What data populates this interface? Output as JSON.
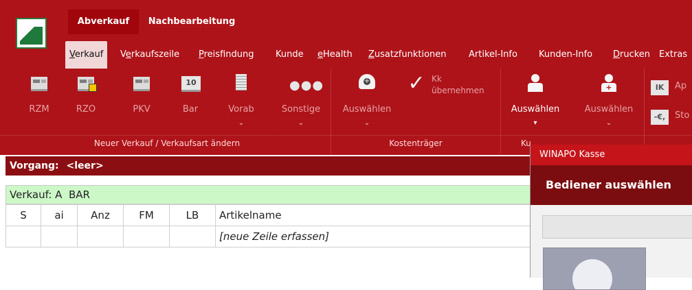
{
  "app": {
    "top_tabs": [
      "Abverkauf",
      "Nachbearbeitung"
    ],
    "menu": [
      {
        "label": "Verkauf",
        "ul": "V",
        "rest": "erkauf",
        "active": true
      },
      {
        "label": "Verkaufszeile",
        "ul": "e",
        "pre": "V",
        "rest": "rkaufszeile"
      },
      {
        "label": "Preisfindung",
        "ul": "P",
        "rest": "reisfindung"
      },
      {
        "label": "Kunde"
      },
      {
        "label": "eHealth",
        "ul": "e",
        "rest": "Health"
      },
      {
        "label": "Zusatzfunktionen",
        "ul": "Z",
        "rest": "usatzfunktionen"
      },
      {
        "label": "Artikel-Info"
      },
      {
        "label": "Kunden-Info"
      },
      {
        "label": "Drucken",
        "ul": "D",
        "rest": "rucken"
      },
      {
        "label": "Extras"
      }
    ],
    "ribbon": {
      "buttons": {
        "rzm": "RZM",
        "rzo": "RZO",
        "pkv": "PKV",
        "bar": "Bar",
        "bar_number": "10",
        "vorab": "Vorab",
        "sonstige": "Sonstige",
        "kt_auswaehlen": "Auswählen",
        "kk_line1": "Kk",
        "kk_line2": "übernehmen",
        "kunde_auswaehlen": "Auswählen",
        "kunde2_auswaehlen": "Auswählen",
        "ik_label": "IK",
        "ap_label": "Ap",
        "euro_label": "-€,",
        "sto_label": "Sto"
      },
      "groups": {
        "neuer_verkauf": "Neuer Verkauf / Verkaufsart ändern",
        "kostentraeger": "Kostenträger",
        "kunde_truncated": "Ku"
      }
    }
  },
  "vorgang": {
    "label": "Vorgang:",
    "value": "<leer>"
  },
  "verkauf": {
    "text": "Verkauf: A  BAR"
  },
  "table": {
    "columns": [
      "S",
      "ai",
      "Anz",
      "FM",
      "LB",
      "Artikelname"
    ],
    "new_row_text": "[neue Zeile erfassen]"
  },
  "dialog": {
    "title": "WINAPO Kasse",
    "heading": "Bediener auswählen"
  },
  "colors": {
    "ribbon": "#b7141a",
    "vorgang_bar": "#8b0f12",
    "verkauf_bar": "#ccf8c8",
    "dialog_title": "#c6141b"
  }
}
